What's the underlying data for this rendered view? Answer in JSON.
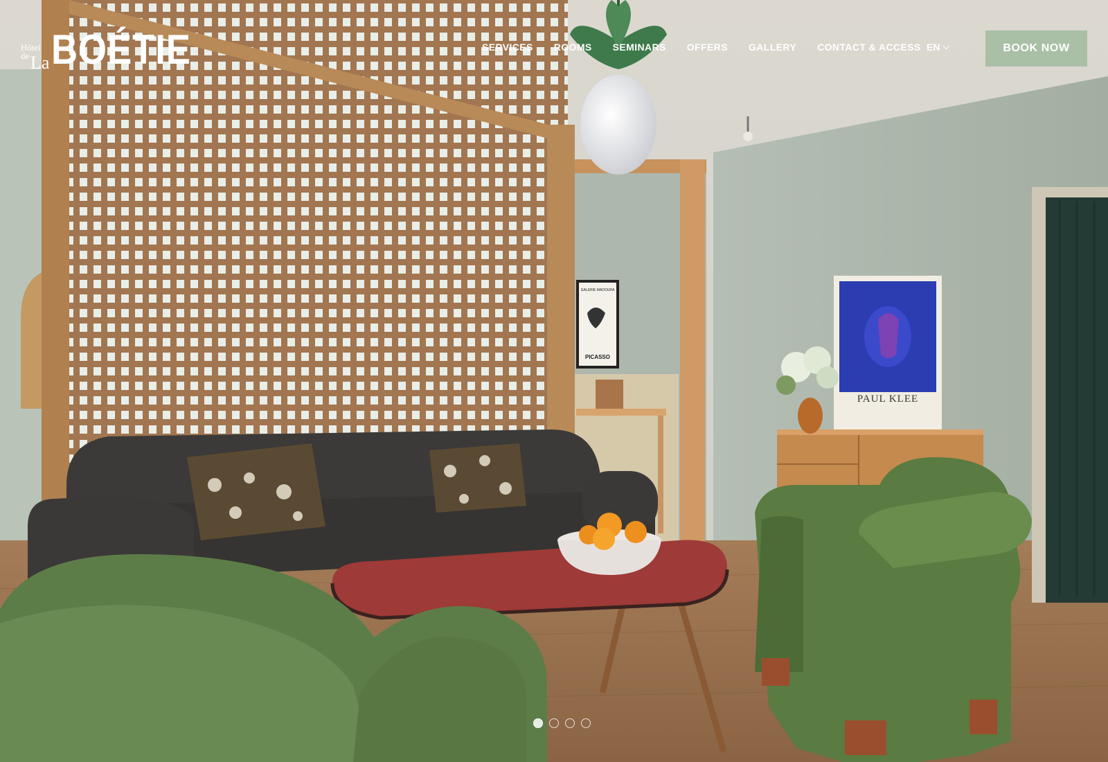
{
  "brand": {
    "hotel": "Hôtel",
    "de": "de",
    "la": "La",
    "name": "BOÉTIE"
  },
  "nav": {
    "items": [
      {
        "label": "SERVICES"
      },
      {
        "label": "ROOMS"
      },
      {
        "label": "SEMINARS"
      },
      {
        "label": "OFFERS"
      },
      {
        "label": "GALLERY"
      },
      {
        "label": "CONTACT & ACCESS"
      }
    ]
  },
  "language": {
    "current": "EN",
    "icon": "chevron-down-icon"
  },
  "cta": {
    "book_label": "BOOK NOW"
  },
  "hero": {
    "posters": {
      "klee": "PAUL KLEE",
      "picasso": "PICASSO",
      "galerie": "GALERIE MADOURA"
    },
    "slider": {
      "count": 4,
      "active": 1
    }
  },
  "colors": {
    "book_button": "#a9bfa6",
    "wall": "#aab4a8",
    "velvet": "#5c7a45",
    "sofa": "#3a3937",
    "table": "#9e3a37",
    "lattice": "#9a6e45"
  }
}
